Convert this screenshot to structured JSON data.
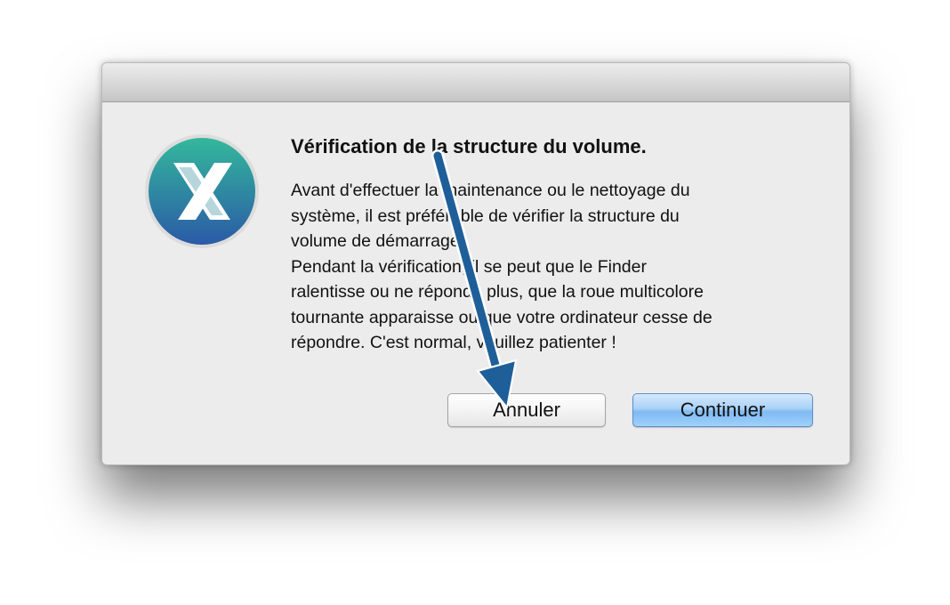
{
  "dialog": {
    "title": "Vérification de la structure du volume.",
    "message_lines": [
      "Avant d'effectuer la maintenance ou le nettoyage du",
      "système, il est préférable de vérifier la structure du",
      "volume de démarrage.",
      "Pendant la vérification, il se peut que le Finder",
      "ralentisse ou ne réponde plus, que la roue multicolore",
      "tournante apparaisse ou que votre ordinateur cesse de",
      "répondre. C'est normal, veuillez patienter !"
    ],
    "cancel_label": "Annuler",
    "continue_label": "Continuer",
    "app_icon": "onyx-x-logo-icon"
  },
  "annotation": {
    "icon": "arrow-down-icon",
    "color": "#1f5f99"
  },
  "colors": {
    "window_background": "#ececec",
    "default_button": "#8fc4f6",
    "icon_teal": "#2ea89a",
    "icon_blue": "#2a5fa6"
  }
}
